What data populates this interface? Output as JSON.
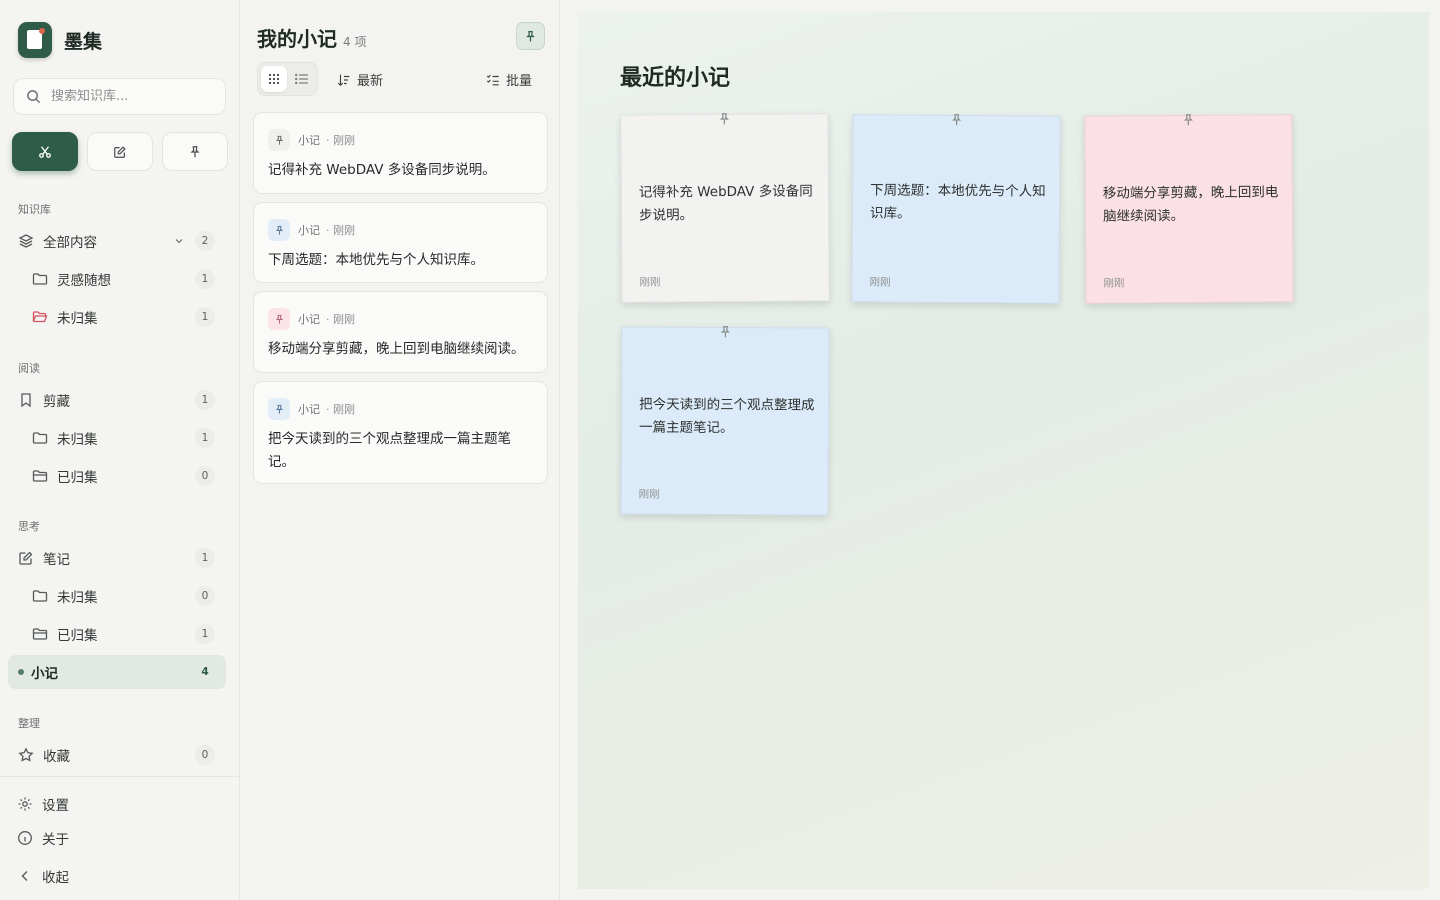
{
  "app": {
    "name": "墨集"
  },
  "search": {
    "placeholder": "搜索知识库..."
  },
  "sidebar": {
    "sections": {
      "library": "知识库",
      "reading": "阅读",
      "thinking": "思考",
      "organize": "整理"
    },
    "items": {
      "all": {
        "label": "全部内容",
        "count": "2"
      },
      "inspiration": {
        "label": "灵感随想",
        "count": "1"
      },
      "unfiled_top": {
        "label": "未归集",
        "count": "1"
      },
      "clippings": {
        "label": "剪藏",
        "count": "1"
      },
      "clip_unfiled": {
        "label": "未归集",
        "count": "1"
      },
      "clip_filed": {
        "label": "已归集",
        "count": "0"
      },
      "notes": {
        "label": "笔记",
        "count": "1"
      },
      "note_unfiled": {
        "label": "未归集",
        "count": "0"
      },
      "note_filed": {
        "label": "已归集",
        "count": "1"
      },
      "memos": {
        "label": "小记",
        "count": "4"
      },
      "favorites": {
        "label": "收藏",
        "count": "0"
      }
    },
    "footer": {
      "settings": "设置",
      "about": "关于",
      "collapse": "收起"
    }
  },
  "list": {
    "title": "我的小记",
    "count_label": "4 项",
    "sort_label": "最新",
    "batch_label": "批量",
    "items": [
      {
        "type": "小记",
        "time": "· 刚刚",
        "text": "记得补充 WebDAV 多设备同步说明。"
      },
      {
        "type": "小记",
        "time": "· 刚刚",
        "text": "下周选题：本地优先与个人知识库。"
      },
      {
        "type": "小记",
        "time": "· 刚刚",
        "text": "移动端分享剪藏，晚上回到电脑继续阅读。"
      },
      {
        "type": "小记",
        "time": "· 刚刚",
        "text": "把今天读到的三个观点整理成一篇主题笔记。"
      }
    ]
  },
  "main": {
    "title": "最近的小记",
    "notes": [
      {
        "text": "记得补充 WebDAV 多设备同步说明。",
        "date": "刚刚",
        "color": "#f2f2f1"
      },
      {
        "text": "下周选题：本地优先与个人知识库。",
        "date": "刚刚",
        "color": "#dcebf9"
      },
      {
        "text": "移动端分享剪藏，晚上回到电脑继续阅读。",
        "date": "刚刚",
        "color": "#fbe0e5"
      },
      {
        "text": "把今天读到的三个观点整理成一篇主题笔记。",
        "date": "刚刚",
        "color": "#dcebf9"
      }
    ]
  },
  "colors": {
    "accent": "#2f5b49",
    "pin_gray": "#f0f0ee",
    "pin_blue": "#e2edf8",
    "pin_pink": "#fbe3e8"
  }
}
